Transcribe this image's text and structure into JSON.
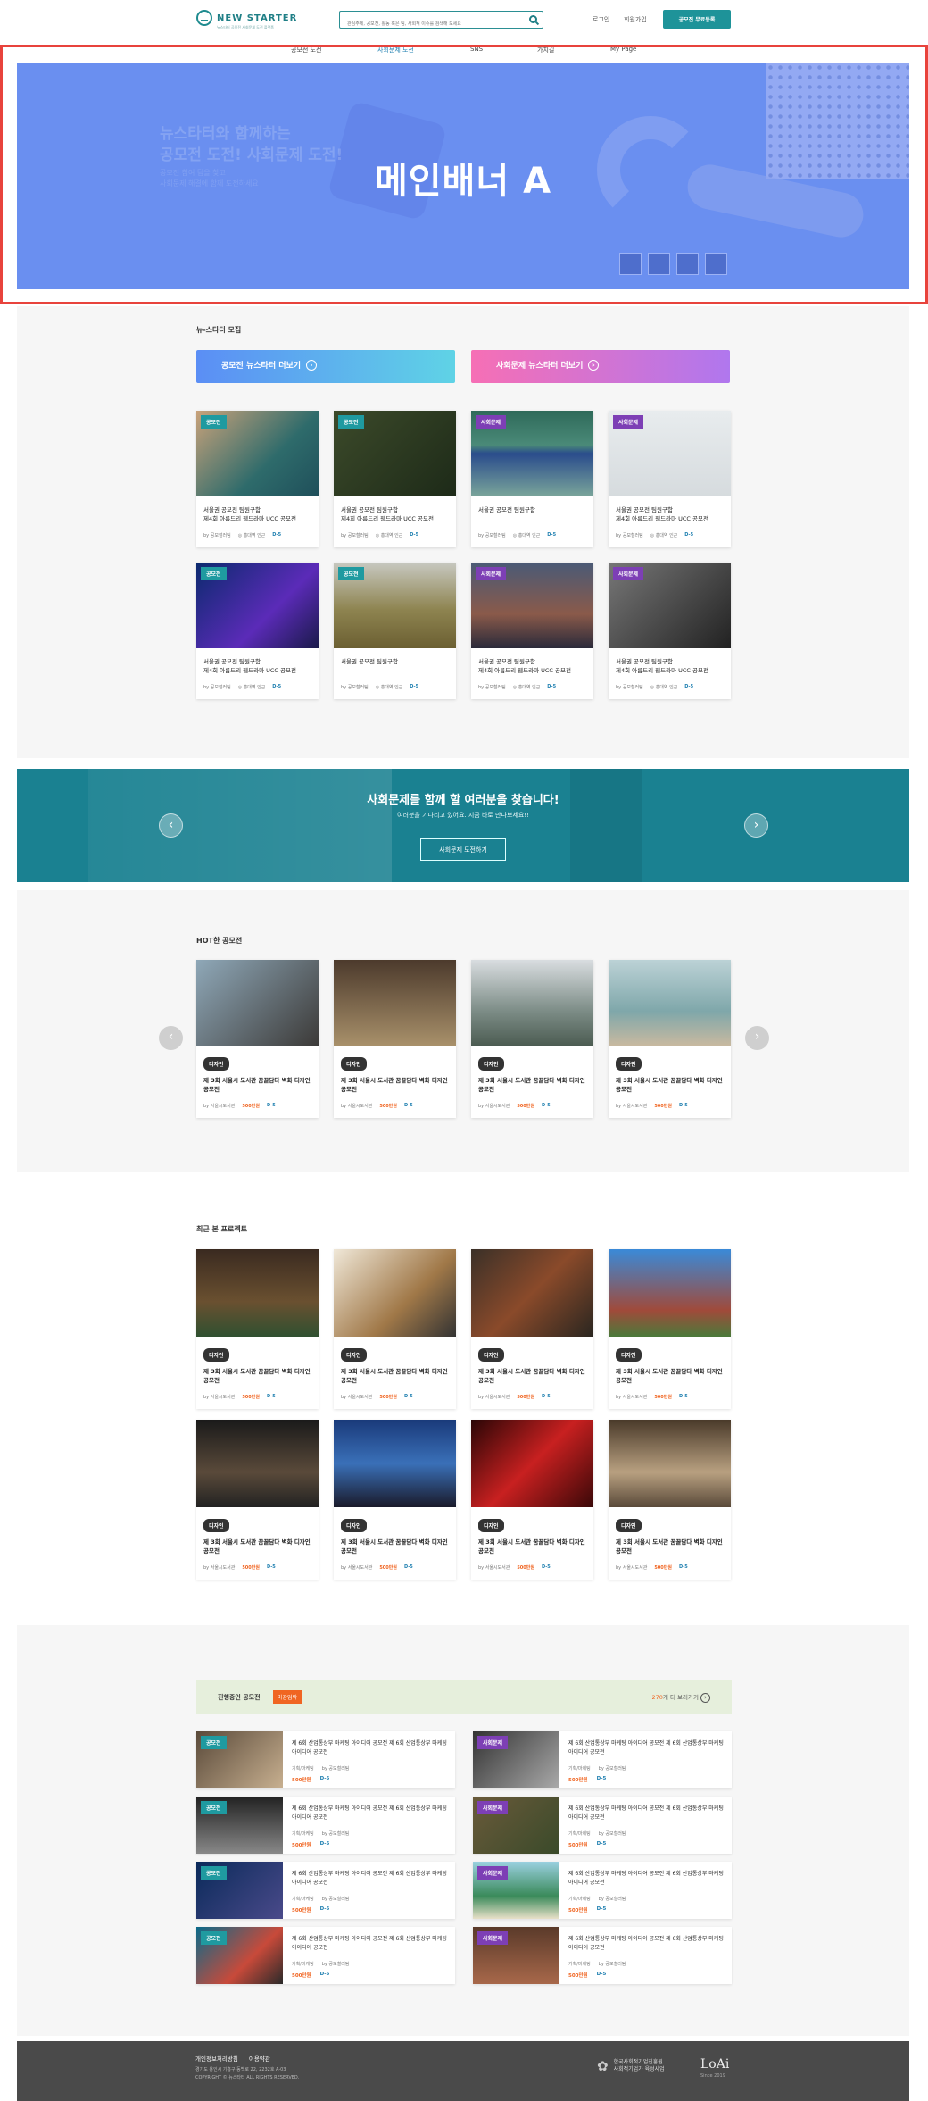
{
  "header": {
    "logo": "NEW STARTER",
    "logo_sub": "뉴스타터 공모전 사회문제 도전 플랫폼",
    "search_placeholder": "관심주제, 공모전, 활동 혹은 팀, 사회적 이슈를 검색해 보세요",
    "login": "로그인",
    "signup": "회원가입",
    "register_button": "공모전 무료등록",
    "nav": [
      "공모전 도전",
      "사회문제 도전",
      "SNS",
      "가치길",
      "My Page"
    ],
    "nav_active": 1
  },
  "banner": {
    "title": "메인배너 A",
    "ghost_line1": "뉴스타터와 함께하는",
    "ghost_line2": "공모전 도전! 사회문제 도전!",
    "ghost_sub1": "공모전 참여 팀을 찾고",
    "ghost_sub2": "사회문제 해결에 함께 도전하세요",
    "accent": "#6a8ff0"
  },
  "newstarter": {
    "title": "뉴-스타터 모집",
    "btn_contest": "공모전 뉴스타터 더보기",
    "btn_social": "사회문제 뉴스타터 더보기",
    "cards": [
      {
        "badge": "공모전",
        "badge_color": "teal",
        "line1": "서울권 공모전 팀원구함",
        "line2": "제4회 아름드리 웹드라마 UCC 공모전",
        "by": "by 공모철러팀",
        "loc": "홍대역 인근",
        "dday": "D-5"
      },
      {
        "badge": "공모전",
        "badge_color": "teal",
        "line1": "서울권 공모전 팀원구함",
        "line2": "제4회 아름드리 웹드라마 UCC 공모전",
        "by": "by 공모철러팀",
        "loc": "홍대역 인근",
        "dday": "D-5"
      },
      {
        "badge": "사회문제",
        "badge_color": "purple",
        "line1": "서울권 공모전 팀원구함",
        "line2": "",
        "by": "by 공모철러팀",
        "loc": "홍대역 인근",
        "dday": "D-5"
      },
      {
        "badge": "사회문제",
        "badge_color": "purple",
        "line1": "서울권 공모전 팀원구함",
        "line2": "제4회 아름드리 웹드라마 UCC 공모전",
        "by": "by 공모철러팀",
        "loc": "홍대역 인근",
        "dday": "D-5"
      },
      {
        "badge": "공모전",
        "badge_color": "teal",
        "line1": "서울권 공모전 팀원구함",
        "line2": "제4회 아름드리 웹드라마 UCC 공모전",
        "by": "by 공모철러팀",
        "loc": "홍대역 인근",
        "dday": "D-5"
      },
      {
        "badge": "공모전",
        "badge_color": "teal",
        "line1": "서울권 공모전 팀원구함",
        "line2": "",
        "by": "by 공모철러팀",
        "loc": "홍대역 인근",
        "dday": "D-5"
      },
      {
        "badge": "사회문제",
        "badge_color": "purple",
        "line1": "서울권 공모전 팀원구함",
        "line2": "제4회 아름드리 웹드라마 UCC 공모전",
        "by": "by 공모철러팀",
        "loc": "홍대역 인근",
        "dday": "D-5"
      },
      {
        "badge": "사회문제",
        "badge_color": "purple",
        "line1": "서울권 공모전 팀원구함",
        "line2": "제4회 아름드리 웹드라마 UCC 공모전",
        "by": "by 공모철러팀",
        "loc": "홍대역 인근",
        "dday": "D-5"
      }
    ]
  },
  "cta": {
    "title": "사회문제를 함께 할 여러분을 찾습니다!",
    "sub": "여러분을 기다리고 있어요. 지금 바로 만나보세요!!",
    "button": "사회문제 도전하기"
  },
  "hot": {
    "title": "HOT한 공모전",
    "cards": [
      {
        "badge": "디자인",
        "title": "제 3회 서울시 도서관 꿈꿀담다 벽화 디자인 공모전",
        "by": "by 서울시도서관",
        "price": "500만원",
        "dday": "D-5"
      },
      {
        "badge": "디자인",
        "title": "제 3회 서울시 도서관 꿈꿀담다 벽화 디자인 공모전",
        "by": "by 서울시도서관",
        "price": "500만원",
        "dday": "D-5"
      },
      {
        "badge": "디자인",
        "title": "제 3회 서울시 도서관 꿈꿀담다 벽화 디자인 공모전",
        "by": "by 서울시도서관",
        "price": "500만원",
        "dday": "D-5"
      },
      {
        "badge": "디자인",
        "title": "제 3회 서울시 도서관 꿈꿀담다 벽화 디자인 공모전",
        "by": "by 서울시도서관",
        "price": "500만원",
        "dday": "D-5"
      }
    ]
  },
  "recent": {
    "title": "최근 본 프로젝트",
    "cards": [
      {
        "badge": "디자인",
        "title": "제 3회 서울시 도서관 꿈꿀담다 벽화 디자인 공모전",
        "by": "by 서울시도서관",
        "price": "500만원",
        "dday": "D-5"
      },
      {
        "badge": "디자인",
        "title": "제 3회 서울시 도서관 꿈꿀담다 벽화 디자인 공모전",
        "by": "by 서울시도서관",
        "price": "500만원",
        "dday": "D-5"
      },
      {
        "badge": "디자인",
        "title": "제 3회 서울시 도서관 꿈꿀담다 벽화 디자인 공모전",
        "by": "by 서울시도서관",
        "price": "500만원",
        "dday": "D-5"
      },
      {
        "badge": "디자인",
        "title": "제 3회 서울시 도서관 꿈꿀담다 벽화 디자인 공모전",
        "by": "by 서울시도서관",
        "price": "500만원",
        "dday": "D-5"
      },
      {
        "badge": "디자인",
        "title": "제 3회 서울시 도서관 꿈꿀담다 벽화 디자인 공모전",
        "by": "by 서울시도서관",
        "price": "500만원",
        "dday": "D-5"
      },
      {
        "badge": "디자인",
        "title": "제 3회 서울시 도서관 꿈꿀담다 벽화 디자인 공모전",
        "by": "by 서울시도서관",
        "price": "500만원",
        "dday": "D-5"
      },
      {
        "badge": "디자인",
        "title": "제 3회 서울시 도서관 꿈꿀담다 벽화 디자인 공모전",
        "by": "by 서울시도서관",
        "price": "500만원",
        "dday": "D-5"
      },
      {
        "badge": "디자인",
        "title": "제 3회 서울시 도서관 꿈꿀담다 벽화 디자인 공모전",
        "by": "by 서울시도서관",
        "price": "500만원",
        "dday": "D-5"
      }
    ]
  },
  "ongoing": {
    "title": "진행중인 공모전",
    "badge": "마감임박",
    "more_count": "270",
    "more_text": "개 더 보러가기",
    "items": [
      {
        "badge": "공모전",
        "badge_color": "teal",
        "title": "제 6회 산업통상부 마케팅 아이디어 공모전 제 6회 산업통상부 마케팅 아이디어 공모전",
        "cat": "기획/마케팅",
        "by": "by 공모철러팀",
        "price": "500만원",
        "dday": "D-5"
      },
      {
        "badge": "사회문제",
        "badge_color": "purple",
        "title": "제 6회 산업통상부 마케팅 아이디어 공모전 제 6회 산업통상부 마케팅 아이디어 공모전",
        "cat": "기획/마케팅",
        "by": "by 공모철러팀",
        "price": "500만원",
        "dday": "D-5"
      },
      {
        "badge": "공모전",
        "badge_color": "teal",
        "title": "제 6회 산업통상부 마케팅 아이디어 공모전 제 6회 산업통상부 마케팅 아이디어 공모전",
        "cat": "기획/마케팅",
        "by": "by 공모철러팀",
        "price": "500만원",
        "dday": "D-5"
      },
      {
        "badge": "사회문제",
        "badge_color": "purple",
        "title": "제 6회 산업통상부 마케팅 아이디어 공모전 제 6회 산업통상부 마케팅 아이디어 공모전",
        "cat": "기획/마케팅",
        "by": "by 공모철러팀",
        "price": "500만원",
        "dday": "D-5"
      },
      {
        "badge": "공모전",
        "badge_color": "teal",
        "title": "제 6회 산업통상부 마케팅 아이디어 공모전 제 6회 산업통상부 마케팅 아이디어 공모전",
        "cat": "기획/마케팅",
        "by": "by 공모철러팀",
        "price": "500만원",
        "dday": "D-5"
      },
      {
        "badge": "사회문제",
        "badge_color": "purple",
        "title": "제 6회 산업통상부 마케팅 아이디어 공모전 제 6회 산업통상부 마케팅 아이디어 공모전",
        "cat": "기획/마케팅",
        "by": "by 공모철러팀",
        "price": "500만원",
        "dday": "D-5"
      },
      {
        "badge": "공모전",
        "badge_color": "teal",
        "title": "제 6회 산업통상부 마케팅 아이디어 공모전 제 6회 산업통상부 마케팅 아이디어 공모전",
        "cat": "기획/마케팅",
        "by": "by 공모철러팀",
        "price": "500만원",
        "dday": "D-5"
      },
      {
        "badge": "사회문제",
        "badge_color": "purple",
        "title": "제 6회 산업통상부 마케팅 아이디어 공모전 제 6회 산업통상부 마케팅 아이디어 공모전",
        "cat": "기획/마케팅",
        "by": "by 공모철러팀",
        "price": "500만원",
        "dday": "D-5"
      }
    ]
  },
  "footer": {
    "privacy": "개인정보처리방침",
    "terms": "이용약관",
    "address": "경기도 용인시 기흥구 동백로 22, 2232호 A-03",
    "copyright": "COPYRIGHT © 뉴스타터 ALL RIGHTS RESERVED.",
    "partner1": "한국사회적기업진흥원",
    "partner2": "사회적기업가 육성사업",
    "brand": "LoAi",
    "since": "Since 2019"
  },
  "colors": {
    "teal": "#1f9aa0",
    "purple": "#7d3fb5",
    "orange": "#f06522",
    "frame": "#e8433c"
  }
}
